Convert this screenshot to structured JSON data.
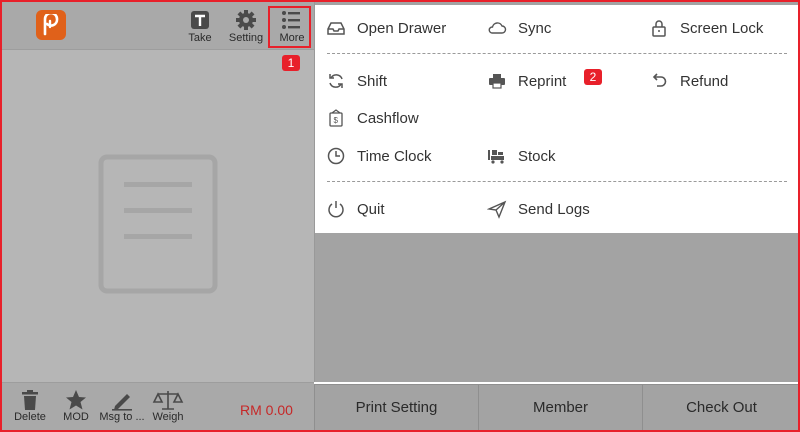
{
  "toolbar": {
    "take_label": "Take",
    "setting_label": "Setting",
    "more_label": "More",
    "badge_more": "1"
  },
  "bottom_bar": {
    "delete_label": "Delete",
    "mod_label": "MOD",
    "msg_label": "Msg to ...",
    "weigh_label": "Weigh",
    "total": "RM 0.00"
  },
  "menu": {
    "open_drawer": "Open Drawer",
    "sync": "Sync",
    "screen_lock": "Screen Lock",
    "shift": "Shift",
    "reprint": "Reprint",
    "reprint_badge": "2",
    "refund": "Refund",
    "cashflow": "Cashflow",
    "time_clock": "Time Clock",
    "stock": "Stock",
    "quit": "Quit",
    "send_logs": "Send Logs"
  },
  "actions": {
    "print_setting": "Print Setting",
    "member": "Member",
    "check_out": "Check Out"
  },
  "colors": {
    "highlight": "#e8202a",
    "logo": "#e0611a",
    "total_text": "#c62828"
  }
}
